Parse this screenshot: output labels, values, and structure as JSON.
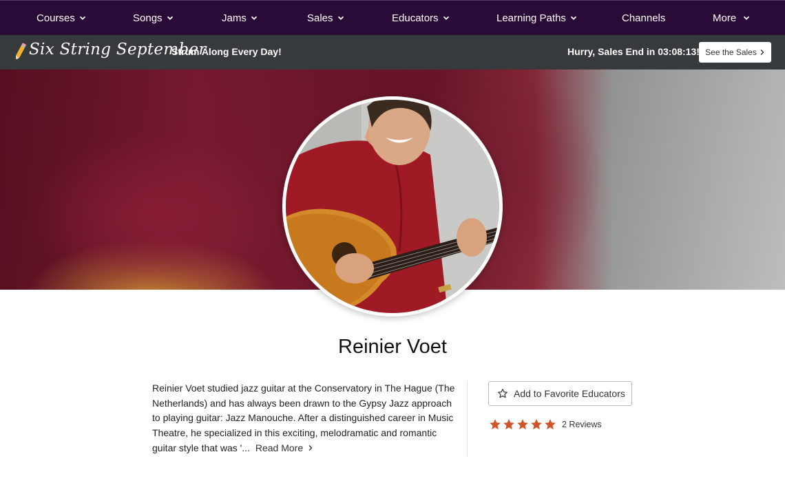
{
  "nav": {
    "items": [
      {
        "label": "Courses",
        "dropdown": true
      },
      {
        "label": "Songs",
        "dropdown": true
      },
      {
        "label": "Jams",
        "dropdown": true
      },
      {
        "label": "Sales",
        "dropdown": true
      },
      {
        "label": "Educators",
        "dropdown": true
      },
      {
        "label": "Learning Paths",
        "dropdown": true
      },
      {
        "label": "Channels",
        "dropdown": false
      },
      {
        "label": "More",
        "dropdown": true
      }
    ]
  },
  "promo": {
    "title": "Six String September",
    "subtitle": "Strum Along Every Day!",
    "timer_text": "Hurry, Sales End in 03:08:13!",
    "button_label": "See the Sales",
    "icon": "pencil-icon"
  },
  "educator": {
    "name": "Reinier Voet",
    "bio": "Reinier Voet studied jazz guitar at the Conservatory in The Hague (The Netherlands) and has always been drawn to the Gypsy Jazz approach to playing guitar: Jazz Manouche. After a distinguished career in Music Theatre, he specialized in this exciting, melodramatic and romantic guitar style that was '...",
    "read_more": "Read More",
    "favorite_label": "Add to Favorite Educators",
    "rating": 5,
    "reviews_label": "2 Reviews"
  },
  "colors": {
    "nav_bg": "#2a0a36",
    "promo_bg": "#363a3d",
    "star": "#d0552a"
  }
}
